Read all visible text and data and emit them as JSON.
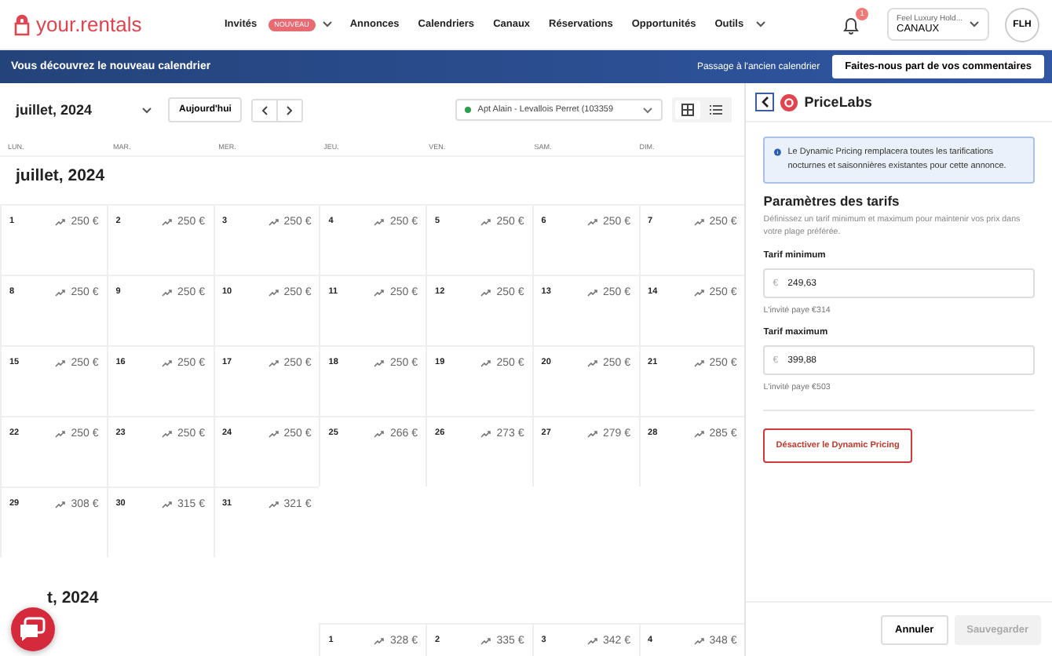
{
  "header": {
    "logo": "your.rentals",
    "nav": [
      {
        "label": "Invités",
        "badge": "NOUVEAU",
        "dropdown": true
      },
      {
        "label": "Annonces",
        "dropdown": false
      },
      {
        "label": "Calendriers",
        "dropdown": false
      },
      {
        "label": "Canaux",
        "dropdown": false
      },
      {
        "label": "Réservations",
        "dropdown": false
      },
      {
        "label": "Opportunités",
        "dropdown": false
      },
      {
        "label": "Outils",
        "dropdown": true
      }
    ],
    "notification_count": "1",
    "account": {
      "name": "Feel Luxury Hold...",
      "role": "CANAUX"
    },
    "avatar": "FLH"
  },
  "banner": {
    "text": "Vous découvrez le nouveau calendrier",
    "link": "Passage à l'ancien calendrier",
    "button": "Faites-nous part de vos commentaires"
  },
  "toolbar": {
    "month": "juillet, 2024",
    "today": "Aujourd'hui",
    "listing": "Apt Alain - Levallois Perret (103359",
    "views": [
      {
        "kind": "grid",
        "selected": true
      },
      {
        "kind": "list",
        "selected": false
      }
    ]
  },
  "weekdays": [
    "LUN.",
    "MAR.",
    "MER.",
    "JEU.",
    "VEN.",
    "SAM.",
    "DIM."
  ],
  "months": [
    {
      "title": "juillet, 2024",
      "weeks": [
        [
          {
            "day": "1",
            "price": "250 €"
          },
          {
            "day": "2",
            "price": "250 €"
          },
          {
            "day": "3",
            "price": "250 €"
          },
          {
            "day": "4",
            "price": "250 €"
          },
          {
            "day": "5",
            "price": "250 €"
          },
          {
            "day": "6",
            "price": "250 €"
          },
          {
            "day": "7",
            "price": "250 €"
          }
        ],
        [
          {
            "day": "8",
            "price": "250 €"
          },
          {
            "day": "9",
            "price": "250 €"
          },
          {
            "day": "10",
            "price": "250 €"
          },
          {
            "day": "11",
            "price": "250 €"
          },
          {
            "day": "12",
            "price": "250 €"
          },
          {
            "day": "13",
            "price": "250 €"
          },
          {
            "day": "14",
            "price": "250 €"
          }
        ],
        [
          {
            "day": "15",
            "price": "250 €"
          },
          {
            "day": "16",
            "price": "250 €"
          },
          {
            "day": "17",
            "price": "250 €"
          },
          {
            "day": "18",
            "price": "250 €"
          },
          {
            "day": "19",
            "price": "250 €"
          },
          {
            "day": "20",
            "price": "250 €"
          },
          {
            "day": "21",
            "price": "250 €"
          }
        ],
        [
          {
            "day": "22",
            "price": "250 €"
          },
          {
            "day": "23",
            "price": "250 €"
          },
          {
            "day": "24",
            "price": "250 €"
          },
          {
            "day": "25",
            "price": "266 €"
          },
          {
            "day": "26",
            "price": "273 €"
          },
          {
            "day": "27",
            "price": "279 €"
          },
          {
            "day": "28",
            "price": "285 €"
          }
        ],
        [
          {
            "day": "29",
            "price": "308 €"
          },
          {
            "day": "30",
            "price": "315 €"
          },
          {
            "day": "31",
            "price": "321 €"
          },
          {
            "kind": "empty"
          },
          {
            "kind": "empty"
          },
          {
            "kind": "empty"
          },
          {
            "kind": "empty"
          }
        ]
      ]
    },
    {
      "title": "t, 2024",
      "weeks": [
        [
          {
            "kind": "empty"
          },
          {
            "kind": "empty"
          },
          {
            "kind": "empty"
          },
          {
            "day": "1",
            "price": "328 €"
          },
          {
            "day": "2",
            "price": "335 €"
          },
          {
            "day": "3",
            "price": "342 €"
          },
          {
            "day": "4",
            "price": "348 €"
          }
        ]
      ]
    }
  ],
  "panel": {
    "title": "PriceLabs",
    "info": "Le Dynamic Pricing remplacera toutes les tarifications nocturnes et saisonnières existantes pour cette annonce.",
    "heading": "Paramètres des tarifs",
    "description": "Définissez un tarif minimum et maximum pour maintenir vos prix dans votre plage préférée.",
    "fields": [
      {
        "label": "Tarif minimum",
        "currency": "€",
        "value": "249,63",
        "hint": "L'invité paye €314"
      },
      {
        "label": "Tarif maximum",
        "currency": "€",
        "value": "399,88",
        "hint": "L'invité paye €503"
      }
    ],
    "deactivate": "Désactiver le Dynamic Pricing",
    "cancel": "Annuler",
    "save": "Sauvegarder",
    "save_disabled": true
  }
}
